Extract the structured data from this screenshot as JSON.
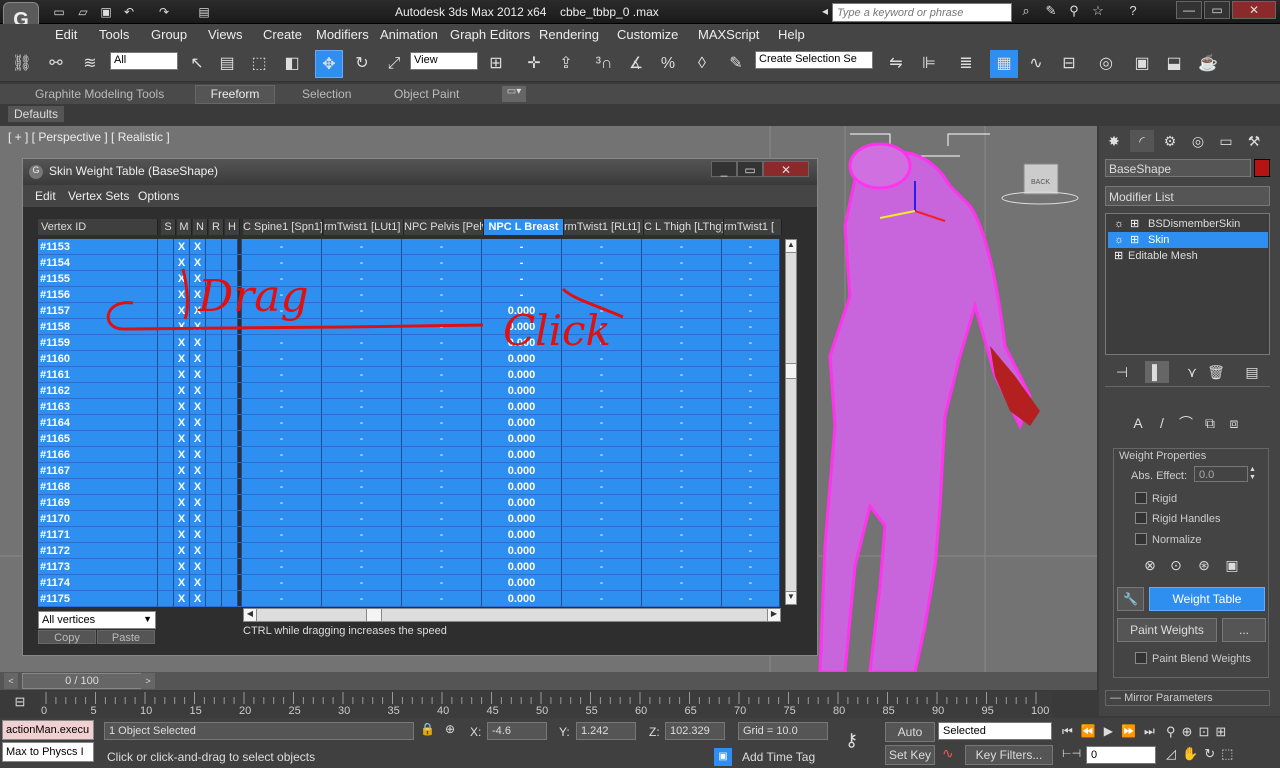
{
  "titlebar": {
    "app_title": "Autodesk 3ds Max  2012 x64",
    "file_title": "cbbe_tbbp_0 .max",
    "search_placeholder": "Type a keyword or phrase"
  },
  "menu": [
    "Edit",
    "Tools",
    "Group",
    "Views",
    "Create",
    "Modifiers",
    "Animation",
    "Graph Editors",
    "Rendering",
    "Customize",
    "MAXScript",
    "Help"
  ],
  "toolbar": {
    "selection_filter": "All",
    "ref_coord": "View",
    "named_selection_placeholder": "Create Selection Se"
  },
  "ribbon": {
    "tabs": [
      "Graphite Modeling Tools",
      "Freeform",
      "Selection",
      "Object Paint"
    ],
    "defaults": "Defaults"
  },
  "viewport": {
    "label": "[ + ] [ Perspective ] [ Realistic ]",
    "viewcube_label": "BACK"
  },
  "dialog": {
    "title": "Skin Weight Table (BaseShape)",
    "menu": [
      "Edit",
      "Vertex Sets",
      "Options"
    ],
    "headers": {
      "vertex_id": "Vertex ID",
      "s": "S",
      "m": "M",
      "n": "N",
      "r": "R",
      "h": "H",
      "bones": [
        "C Spine1 [Spn1]",
        "rmTwist1 [LUt1]",
        "NPC Pelvis [Pelv]",
        "NPC L Breast",
        "rmTwist1 [RLt1]",
        "C L Thigh [LThg]",
        "rmTwist1 ["
      ]
    },
    "rows": [
      {
        "id": "#1153",
        "m": "X",
        "n": "X",
        "breast": "-"
      },
      {
        "id": "#1154",
        "m": "X",
        "n": "X",
        "breast": "-"
      },
      {
        "id": "#1155",
        "m": "X",
        "n": "X",
        "breast": "-"
      },
      {
        "id": "#1156",
        "m": "X",
        "n": "X",
        "breast": "-"
      },
      {
        "id": "#1157",
        "m": "X",
        "n": "X",
        "breast": "0.000"
      },
      {
        "id": "#1158",
        "m": "X",
        "n": "X",
        "breast": "0.000"
      },
      {
        "id": "#1159",
        "m": "X",
        "n": "X",
        "breast": "0.000"
      },
      {
        "id": "#1160",
        "m": "X",
        "n": "X",
        "breast": "0.000"
      },
      {
        "id": "#1161",
        "m": "X",
        "n": "X",
        "breast": "0.000"
      },
      {
        "id": "#1162",
        "m": "X",
        "n": "X",
        "breast": "0.000"
      },
      {
        "id": "#1163",
        "m": "X",
        "n": "X",
        "breast": "0.000"
      },
      {
        "id": "#1164",
        "m": "X",
        "n": "X",
        "breast": "0.000"
      },
      {
        "id": "#1165",
        "m": "X",
        "n": "X",
        "breast": "0.000"
      },
      {
        "id": "#1166",
        "m": "X",
        "n": "X",
        "breast": "0.000"
      },
      {
        "id": "#1167",
        "m": "X",
        "n": "X",
        "breast": "0.000"
      },
      {
        "id": "#1168",
        "m": "X",
        "n": "X",
        "breast": "0.000"
      },
      {
        "id": "#1169",
        "m": "X",
        "n": "X",
        "breast": "0.000"
      },
      {
        "id": "#1170",
        "m": "X",
        "n": "X",
        "breast": "0.000"
      },
      {
        "id": "#1171",
        "m": "X",
        "n": "X",
        "breast": "0.000"
      },
      {
        "id": "#1172",
        "m": "X",
        "n": "X",
        "breast": "0.000"
      },
      {
        "id": "#1173",
        "m": "X",
        "n": "X",
        "breast": "0.000"
      },
      {
        "id": "#1174",
        "m": "X",
        "n": "X",
        "breast": "0.000"
      },
      {
        "id": "#1175",
        "m": "X",
        "n": "X",
        "breast": "0.000"
      }
    ],
    "dash": "-",
    "vertex_filter": "All vertices",
    "copy": "Copy",
    "paste": "Paste",
    "note": "CTRL while dragging increases the speed",
    "annotations": [
      "Drag",
      "Click"
    ]
  },
  "panel": {
    "object_name": "BaseShape",
    "object_color": "#b41414",
    "modifier_list": "Modifier List",
    "stack": [
      "BSDismemberSkin Modifie",
      "Skin",
      "Editable Mesh"
    ],
    "weight_properties": "Weight Properties",
    "abs_effect_label": "Abs. Effect:",
    "abs_effect_value": "0.0",
    "rigid": "Rigid",
    "rigid_handles": "Rigid Handles",
    "normalize": "Normalize",
    "weight_table": "Weight Table",
    "paint_weights": "Paint Weights",
    "ellipsis": "...",
    "paint_blend": "Paint Blend Weights",
    "mirror_parameters": "Mirror Parameters"
  },
  "timeline": {
    "slider": "0 / 100",
    "ticks": [
      "0",
      "5",
      "10",
      "15",
      "20",
      "25",
      "30",
      "35",
      "40",
      "45",
      "50",
      "55",
      "60",
      "65",
      "70",
      "75",
      "80",
      "85",
      "90",
      "95",
      "100"
    ]
  },
  "status": {
    "script1": "actionMan.execu",
    "script2": "Max to Physcs I",
    "selected": "1 Object Selected",
    "prompt": "Click or click-and-drag to select objects",
    "x_label": "X:",
    "x": "-4.6",
    "y_label": "Y:",
    "y": "1.242",
    "z_label": "Z:",
    "z": "102.329",
    "grid": "Grid = 10.0",
    "add_time_tag": "Add Time Tag",
    "auto_key": "Auto Key",
    "key_mode": "Selected",
    "set_key": "Set Key",
    "key_filters": "Key Filters...",
    "frame": "0"
  },
  "colors": {
    "accent": "#2f8ff0",
    "mesh": "#ff33ee",
    "annotation": "#e01010"
  }
}
